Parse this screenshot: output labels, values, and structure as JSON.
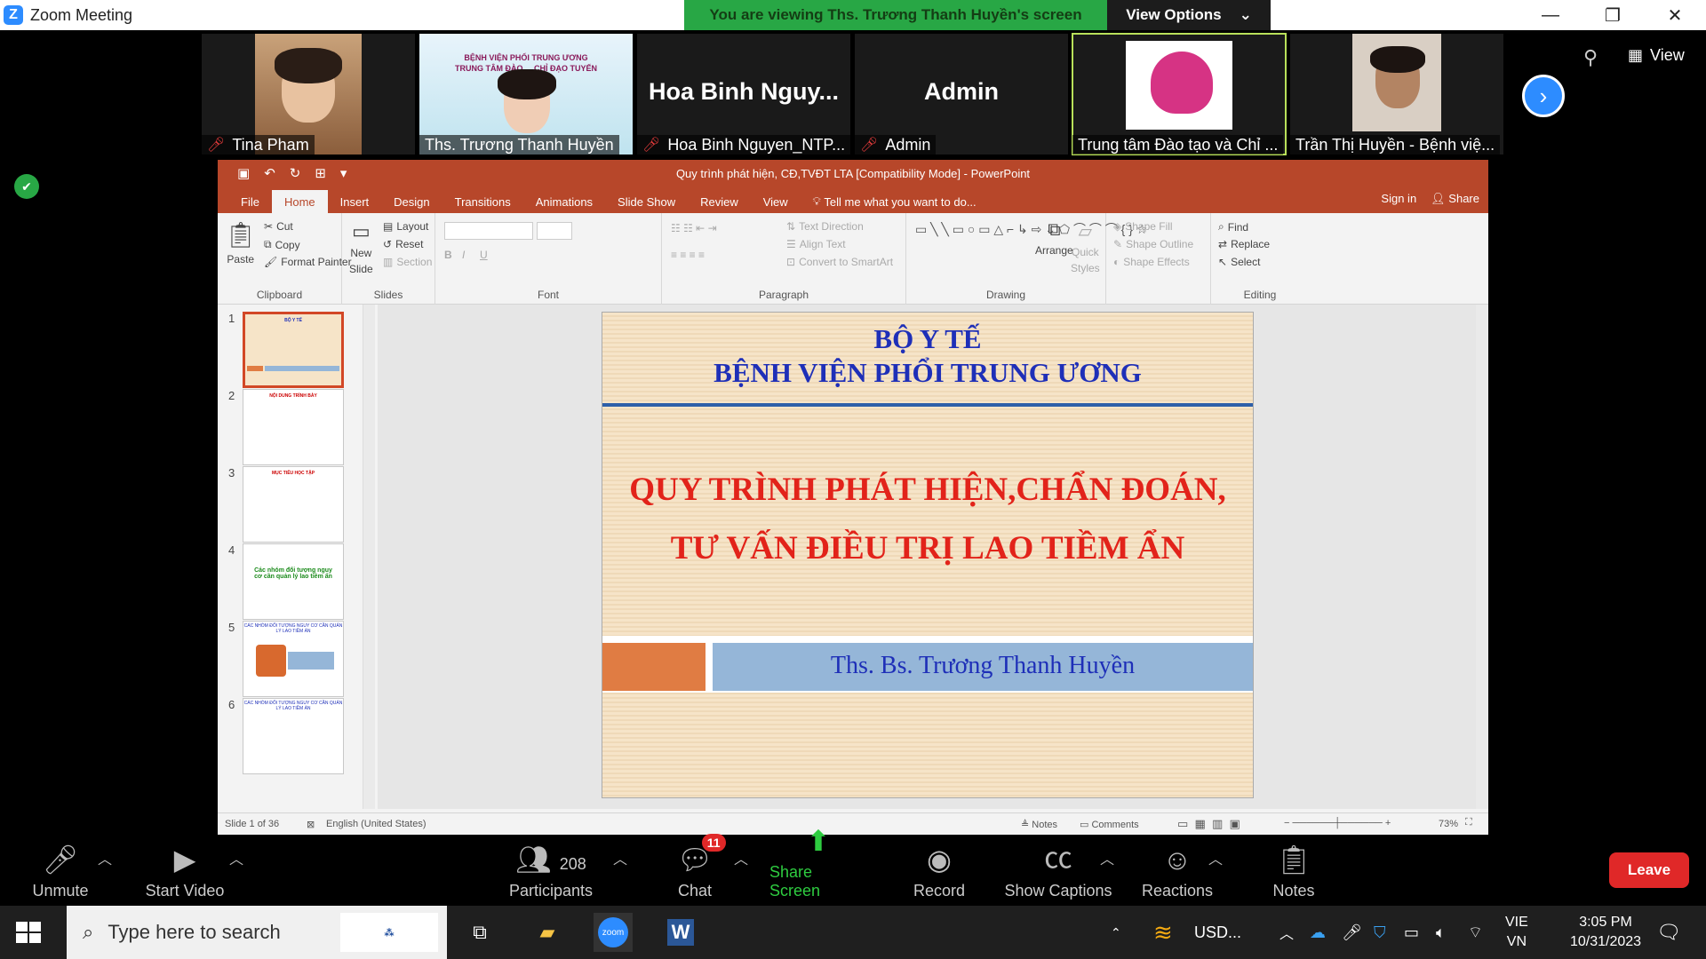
{
  "window": {
    "app_title": "Zoom Meeting",
    "view_banner": "You are viewing Ths. Trương Thanh Huyền's screen",
    "view_options": "View Options",
    "view_button": "View"
  },
  "participants": [
    {
      "name": "Tina Pham",
      "muted": true
    },
    {
      "name": "Ths. Trương Thanh Huyền",
      "muted": false
    },
    {
      "name": "Hoa Binh Nguyen_NTP...",
      "display": "Hoa Binh Nguy...",
      "muted": true
    },
    {
      "name": "Admin",
      "display": "Admin",
      "muted": true
    },
    {
      "name": "Trung tâm Đào tạo và Chỉ ...",
      "muted": false
    },
    {
      "name": "Trần Thị Huyền - Bệnh việ...",
      "muted": false
    }
  ],
  "video_text": {
    "line1": "BỆNH VIỆN PHỔI TRUNG ƯƠNG",
    "line2": "TRUNG TÂM ĐÀO ... CHỈ ĐẠO TUYẾN"
  },
  "ppt": {
    "title": "Quy trình phát hiện, CĐ,TVĐT LTA [Compatibility Mode] - PowerPoint",
    "tabs": [
      "File",
      "Home",
      "Insert",
      "Design",
      "Transitions",
      "Animations",
      "Slide Show",
      "Review",
      "View"
    ],
    "tell_me": "Tell me what you want to do...",
    "sign_in": "Sign in",
    "share": "Share",
    "clipboard": {
      "paste": "Paste",
      "cut": "Cut",
      "copy": "Copy",
      "format_painter": "Format Painter",
      "label": "Clipboard"
    },
    "slides": {
      "new_slide": "New",
      "new_slide2": "Slide",
      "layout": "Layout",
      "reset": "Reset",
      "section": "Section",
      "label": "Slides"
    },
    "font_label": "Font",
    "paragraph": {
      "text_direction": "Text Direction",
      "align_text": "Align Text",
      "convert": "Convert to SmartArt",
      "label": "Paragraph"
    },
    "drawing": {
      "arrange": "Arrange",
      "quick": "Quick",
      "styles": "Styles",
      "fill": "Shape Fill",
      "outline": "Shape Outline",
      "effects": "Shape Effects",
      "label": "Drawing"
    },
    "editing": {
      "find": "Find",
      "replace": "Replace",
      "select": "Select",
      "label": "Editing"
    },
    "thumb_numbers": [
      "1",
      "2",
      "3",
      "4",
      "5",
      "6"
    ],
    "thumb_titles": [
      "BỘ Y TẾ",
      "NỘI DUNG TRÌNH BÀY",
      "MỤC TIÊU HỌC TẬP",
      "Các nhóm đối tượng nguy cơ cần quản lý lao tiềm ẩn",
      "CÁC NHÓM ĐỐI TƯỢNG NGUY CƠ CẦN QUẢN LÝ LAO TIỀM ẨN",
      "CÁC NHÓM ĐỐI TƯỢNG NGUY CƠ CẦN QUẢN LÝ LAO TIỀM ẨN"
    ],
    "slide": {
      "header1": "BỘ Y TẾ",
      "header2": "BỆNH VIỆN PHỔI TRUNG ƯƠNG",
      "title1": "QUY TRÌNH PHÁT HIỆN,CHẨN ĐOÁN,",
      "title2": "TƯ VẤN ĐIỀU TRỊ LAO TIỀM ẨN",
      "author": "Ths. Bs. Trương Thanh Huyền"
    },
    "status": {
      "slide_of": "Slide 1 of 36",
      "language": "English (United States)",
      "notes": "Notes",
      "comments": "Comments",
      "zoom": "73%"
    }
  },
  "toolbar": {
    "unmute": "Unmute",
    "start_video": "Start Video",
    "participants": "Participants",
    "participant_count": "208",
    "chat": "Chat",
    "chat_badge": "11",
    "share": "Share Screen",
    "record": "Record",
    "captions": "Show Captions",
    "reactions": "Reactions",
    "notes": "Notes",
    "leave": "Leave"
  },
  "taskbar": {
    "search_placeholder": "Type here to search",
    "currency": "USD...",
    "lang1": "VIE",
    "lang2": "VN",
    "time": "3:05 PM",
    "date": "10/31/2023"
  }
}
